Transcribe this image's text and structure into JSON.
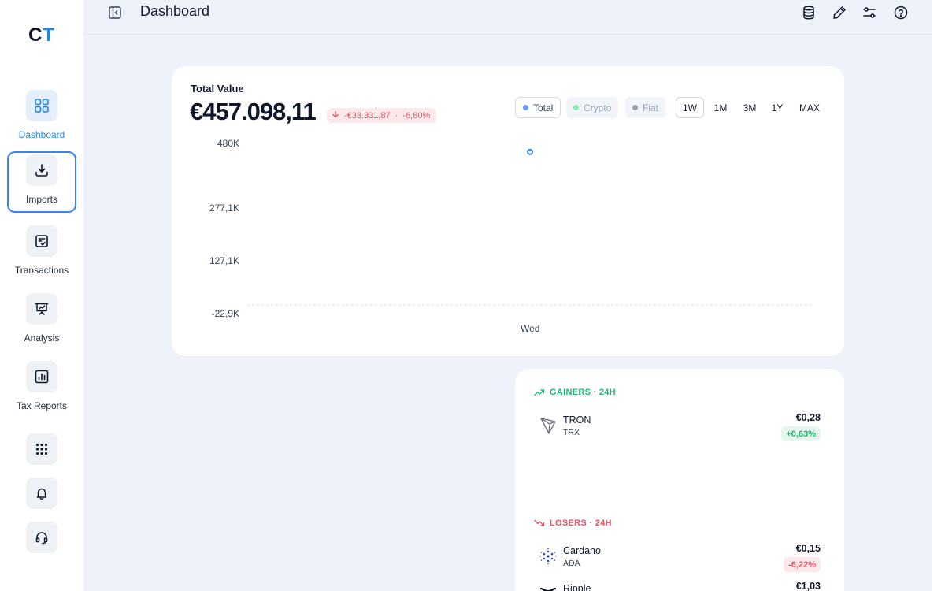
{
  "app": {
    "logo_part1": "C",
    "logo_part2": "T",
    "page_title": "Dashboard",
    "accent_color": "#1e88e5"
  },
  "sidebar": {
    "items": [
      {
        "label": "Dashboard",
        "icon": "grid-icon"
      },
      {
        "label": "Imports",
        "icon": "download-icon"
      },
      {
        "label": "Transactions",
        "icon": "checklist-icon"
      },
      {
        "label": "Analysis",
        "icon": "presentation-chart-icon"
      },
      {
        "label": "Tax Reports",
        "icon": "bar-chart-icon"
      }
    ],
    "buttons": [
      "apps-grid-icon",
      "bell-icon",
      "headset-icon"
    ]
  },
  "topbar": {
    "icons": [
      "database-icon",
      "pencil-icon",
      "sliders-icon",
      "help-icon"
    ]
  },
  "portfolio": {
    "label": "Total Value",
    "amount": "€457.098,11",
    "change_amount": "-€33.331,87",
    "change_separator": "·",
    "change_percent": "-6,80%",
    "filters": [
      "Total",
      "Crypto",
      "Fiat"
    ],
    "ranges": [
      "1W",
      "1M",
      "3M",
      "1Y",
      "MAX"
    ],
    "selected_range": "1W",
    "selected_filter": "Total"
  },
  "chart_data": {
    "type": "line",
    "title": "",
    "xlabel": "",
    "ylabel": "",
    "y_ticks": [
      "480K",
      "277,1K",
      "127,1K",
      "-22,9K"
    ],
    "x_ticks": [
      "Wed"
    ],
    "series": [
      {
        "x": [
          "Wed"
        ],
        "values": [
          457098.11
        ],
        "color": "#3b82f6"
      }
    ],
    "grid": false
  },
  "movers": {
    "gainers_title": "GAINERS · 24H",
    "losers_title": "LOSERS · 24H",
    "gainers": [
      {
        "name": "TRON",
        "symbol": "TRX",
        "price": "€0,28",
        "change": "+0,63%"
      }
    ],
    "losers": [
      {
        "name": "Cardano",
        "symbol": "ADA",
        "price": "€0,15",
        "change": "-6,22%"
      },
      {
        "name": "Ripple",
        "symbol": "",
        "price": "€1,03",
        "change": ""
      }
    ]
  }
}
